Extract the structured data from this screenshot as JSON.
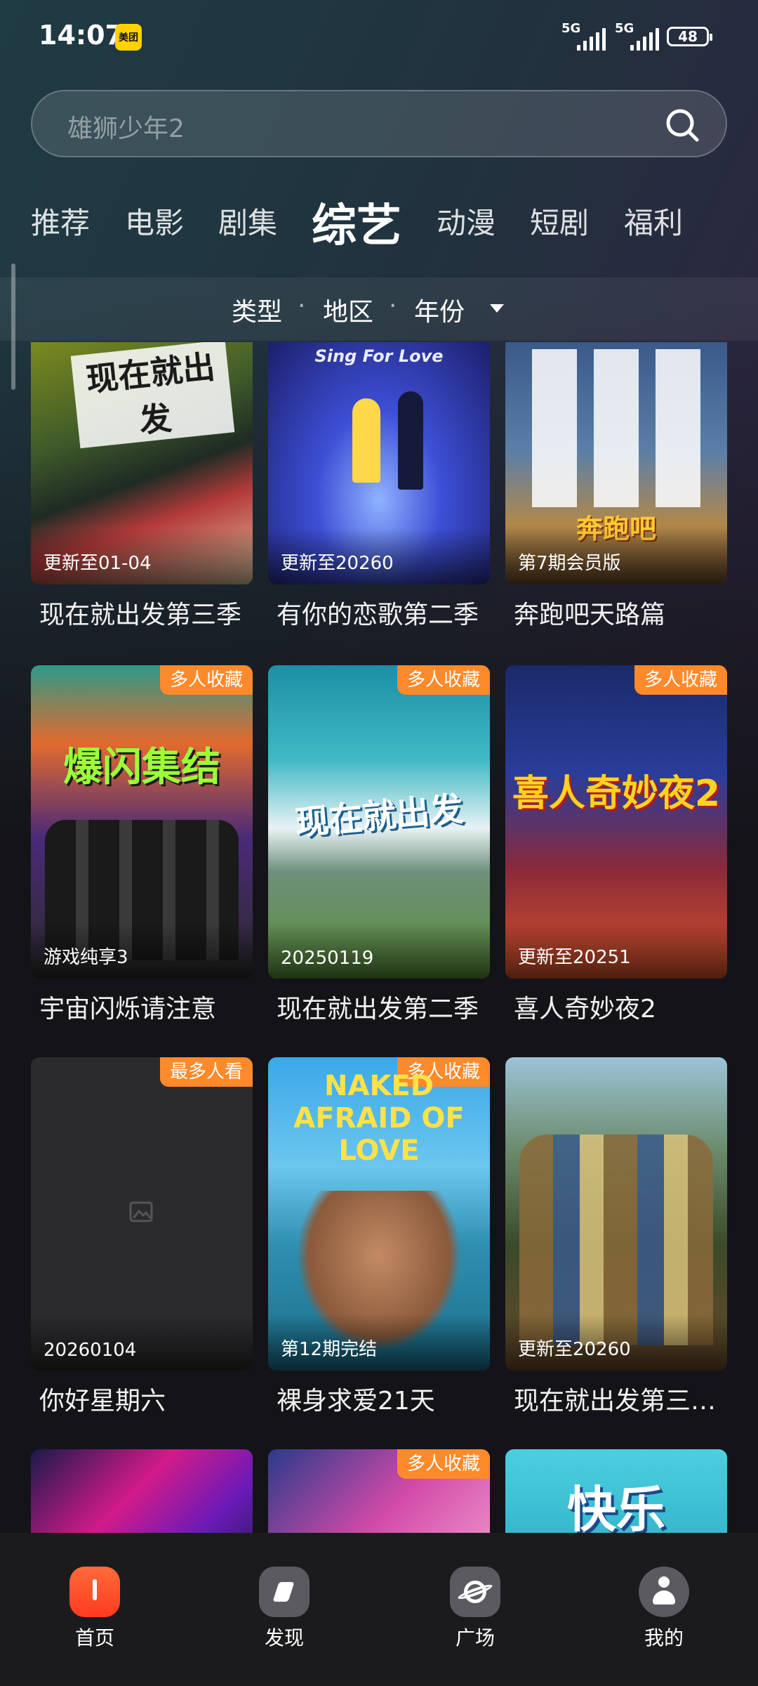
{
  "status": {
    "time": "14:07",
    "app_badge": "美团",
    "sig1_label": "5G",
    "sig2_label": "5G",
    "battery": "48"
  },
  "search": {
    "placeholder": "雄狮少年2"
  },
  "tabs": [
    {
      "label": "推荐"
    },
    {
      "label": "电影"
    },
    {
      "label": "剧集"
    },
    {
      "label": "综艺",
      "active": true
    },
    {
      "label": "动漫"
    },
    {
      "label": "短剧"
    },
    {
      "label": "福利"
    }
  ],
  "filter": {
    "type": "类型",
    "region": "地区",
    "year": "年份",
    "sep": "·"
  },
  "cards": [
    {
      "title": "现在就出发第三季",
      "update": "更新至01-04",
      "badge": "",
      "poster_text": "现在就出发"
    },
    {
      "title": "有你的恋歌第二季",
      "update": "更新至20260",
      "badge": "",
      "poster_text": "Sing For Love"
    },
    {
      "title": "奔跑吧天路篇",
      "update": "第7期会员版",
      "badge": "",
      "poster_text": "奔跑吧"
    },
    {
      "title": "宇宙闪烁请注意",
      "update": "游戏纯享3",
      "badge": "多人收藏",
      "poster_text": "爆闪集结"
    },
    {
      "title": "现在就出发第二季",
      "update": "20250119",
      "badge": "多人收藏",
      "poster_text": "现在就出发"
    },
    {
      "title": "喜人奇妙夜2",
      "update": "更新至20251",
      "badge": "多人收藏",
      "poster_text": "喜人奇妙夜2"
    },
    {
      "title": "你好星期六",
      "update": "20260104",
      "badge": "最多人看",
      "poster_text": ""
    },
    {
      "title": "裸身求爱21天",
      "update": "第12期完结",
      "badge": "多人收藏",
      "poster_text": "NAKED AFRAID OF LOVE"
    },
    {
      "title": "现在就出发第三…",
      "update": "更新至20260",
      "badge": "",
      "poster_text": ""
    },
    {
      "title": "",
      "update": "",
      "badge": "",
      "poster_text": ""
    },
    {
      "title": "",
      "update": "",
      "badge": "多人收藏",
      "poster_text": ""
    },
    {
      "title": "",
      "update": "",
      "badge": "",
      "poster_text": "快乐"
    }
  ],
  "nav": [
    {
      "label": "首页",
      "icon": "home-icon"
    },
    {
      "label": "发现",
      "icon": "discover-icon"
    },
    {
      "label": "广场",
      "icon": "planet-icon"
    },
    {
      "label": "我的",
      "icon": "profile-icon"
    }
  ]
}
